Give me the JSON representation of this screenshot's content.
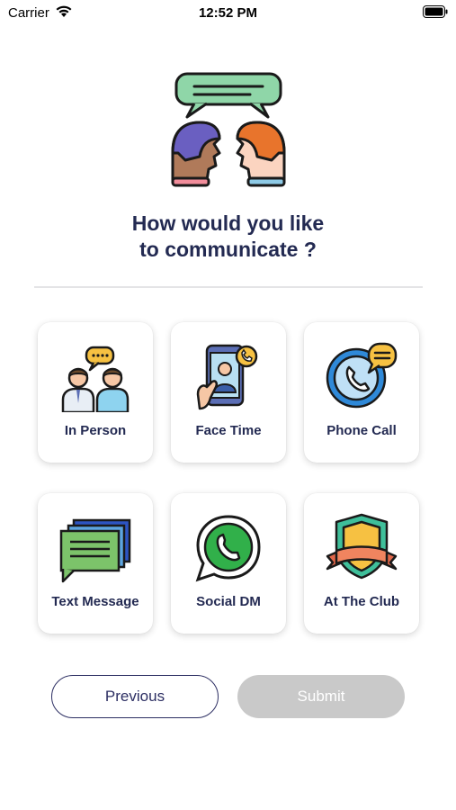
{
  "status": {
    "carrier": "Carrier",
    "time": "12:52 PM"
  },
  "heading": {
    "line1": "How would you like",
    "line2": "to communicate ?"
  },
  "options": [
    {
      "label": "In Person",
      "icon": "two-people-chat-icon"
    },
    {
      "label": "Face Time",
      "icon": "video-call-phone-icon"
    },
    {
      "label": "Phone Call",
      "icon": "phone-call-bubble-icon"
    },
    {
      "label": "Text Message",
      "icon": "text-message-cards-icon"
    },
    {
      "label": "Social DM",
      "icon": "whatsapp-icon"
    },
    {
      "label": "At The Club",
      "icon": "shield-ribbon-icon"
    }
  ],
  "buttons": {
    "previous": "Previous",
    "submit": "Submit"
  },
  "colors": {
    "primary": "#232a52",
    "submit_disabled": "#c9c9c9",
    "divider": "#e4e4e6"
  }
}
